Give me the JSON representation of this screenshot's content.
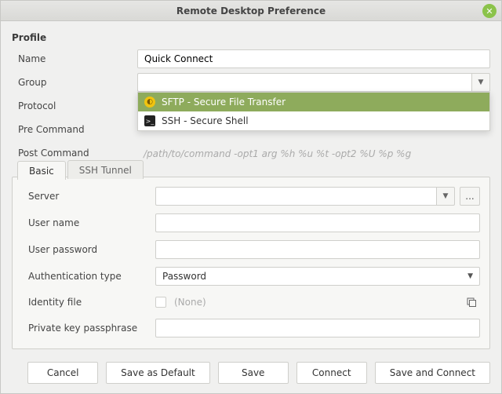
{
  "titlebar": {
    "title": "Remote Desktop Preference"
  },
  "profile": {
    "heading": "Profile",
    "labels": {
      "name": "Name",
      "group": "Group",
      "protocol": "Protocol",
      "pre_command": "Pre Command",
      "post_command": "Post Command"
    },
    "name_value": "Quick Connect",
    "group_value": "",
    "protocol_value": "",
    "protocol_options": {
      "sftp": "SFTP - Secure File Transfer",
      "ssh": "SSH - Secure Shell"
    },
    "command_placeholder": "/path/to/command -opt1 arg %h %u %t -opt2 %U %p %g"
  },
  "tabs": {
    "basic": "Basic",
    "ssh_tunnel": "SSH Tunnel"
  },
  "basic": {
    "labels": {
      "server": "Server",
      "user_name": "User name",
      "user_password": "User password",
      "auth_type": "Authentication type",
      "identity_file": "Identity file",
      "passphrase": "Private key passphrase"
    },
    "server_value": "",
    "user_name_value": "",
    "user_password_value": "",
    "auth_type_value": "Password",
    "identity_file_value": "(None)",
    "passphrase_value": "",
    "more_button": "..."
  },
  "buttons": {
    "cancel": "Cancel",
    "save_default": "Save as Default",
    "save": "Save",
    "connect": "Connect",
    "save_connect": "Save and Connect"
  }
}
